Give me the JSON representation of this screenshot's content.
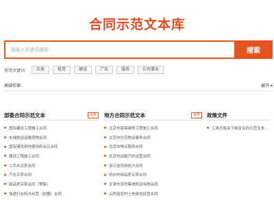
{
  "header": {
    "title": "合同示范文本库"
  },
  "search": {
    "placeholder": "请输入关键词搜索",
    "button_label": "搜索"
  },
  "hot_keywords": {
    "label": "常用关键词:",
    "tags": [
      "买卖",
      "租赁",
      "建设",
      "广告",
      "服务",
      "公司事业"
    ]
  },
  "filter": {
    "label": "高级检索:",
    "expand_label": "展开"
  },
  "columns": [
    {
      "title": "部委合同示范文本",
      "more_label": "更多",
      "items": [
        "国际建设工程施工合同",
        "水域航运运输货物合同",
        "国有建设用地使用权出让合同",
        "建设工程施工合同",
        "二手车买卖合同",
        "汽车买卖合同",
        "商品房买卖合同（预售）",
        "快递行业特许经营（加盟）合同"
      ]
    },
    {
      "title": "地方合同示范文本",
      "more_label": "更多",
      "items": [
        "北京市家具装修工程施工合同",
        "北京市住宅物业服务合同",
        "北京市物业服务合同",
        "北京市出租汽车运营合同",
        "浙江省供用热力合同",
        "杭州市商品房买卖合同",
        "天津市农村集体机动用地合同",
        "山西省农村土地承包经营合同"
      ]
    },
    {
      "title": "政策文件",
      "more_label": "",
      "items": [
        "工商总局关于制定合同示范文本..."
      ]
    }
  ]
}
